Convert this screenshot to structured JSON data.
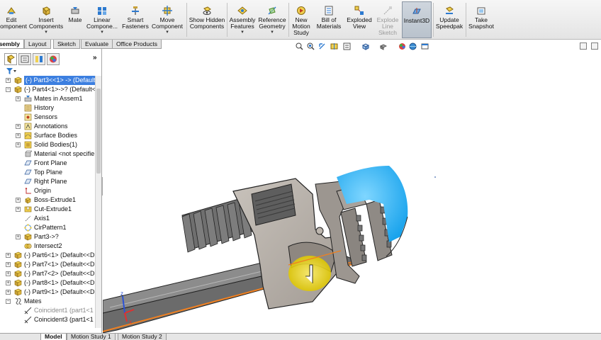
{
  "ribbon": {
    "buttons": [
      {
        "label": "Edit Component",
        "icon": "edit-component-icon"
      },
      {
        "label": "Insert Components",
        "icon": "insert-components-icon"
      },
      {
        "label": "Mate",
        "icon": "mate-icon"
      },
      {
        "label": "Linear Compone...",
        "icon": "linear-pattern-icon"
      },
      {
        "label": "Smart Fasteners",
        "icon": "smart-fasteners-icon"
      },
      {
        "label": "Move Component",
        "icon": "move-component-icon"
      },
      {
        "label": "Show Hidden Components",
        "icon": "show-hidden-icon"
      },
      {
        "label": "Assembly Features",
        "icon": "assembly-features-icon"
      },
      {
        "label": "Reference Geometry",
        "icon": "reference-geometry-icon"
      },
      {
        "label": "New Motion Study",
        "icon": "motion-study-icon"
      },
      {
        "label": "Bill of Materials",
        "icon": "bom-icon"
      },
      {
        "label": "Exploded View",
        "icon": "exploded-view-icon"
      },
      {
        "label": "Explode Line Sketch",
        "icon": "explode-line-icon"
      },
      {
        "label": "Instant3D",
        "icon": "instant3d-icon"
      },
      {
        "label": "Update Speedpak",
        "icon": "speedpak-icon"
      },
      {
        "label": "Take Snapshot",
        "icon": "snapshot-icon"
      }
    ]
  },
  "command_tabs": [
    "Assembly",
    "Layout",
    "Sketch",
    "Evaluate",
    "Office Products"
  ],
  "tree": {
    "nodes": [
      {
        "label": "(-) Part3<<1> -> (Default"
      },
      {
        "label": "(-) Part4<1>->? (Default<"
      },
      {
        "label": "Mates in Assem1"
      },
      {
        "label": "History"
      },
      {
        "label": "Sensors"
      },
      {
        "label": "Annotations"
      },
      {
        "label": "Surface Bodies"
      },
      {
        "label": "Solid Bodies(1)"
      },
      {
        "label": "Material <not specifie"
      },
      {
        "label": "Front Plane"
      },
      {
        "label": "Top Plane"
      },
      {
        "label": "Right Plane"
      },
      {
        "label": "Origin"
      },
      {
        "label": "Boss-Extrude1"
      },
      {
        "label": "Cut-Extrude1"
      },
      {
        "label": "Axis1"
      },
      {
        "label": "CirPattern1"
      },
      {
        "label": "Part3->?"
      },
      {
        "label": "Intersect2"
      },
      {
        "label": "(-) Part6<1> (Default<<D"
      },
      {
        "label": "(-) Part7<1> (Default<<D"
      },
      {
        "label": "(-) Part7<2> (Default<<D"
      },
      {
        "label": "(-) Part8<1> (Default<<D"
      },
      {
        "label": "(-) Part9<1> (Default<<D"
      },
      {
        "label": "Mates"
      },
      {
        "label": "Coincident1 (part1<1"
      },
      {
        "label": "Coincident3 (part1<1"
      }
    ]
  },
  "bottom_tabs": [
    "Model",
    "Motion Study 1",
    "Motion Study 2"
  ],
  "triad": {
    "z": "z",
    "x": "x"
  },
  "colors": {
    "accent": "#3c7fe0",
    "selected_face": "#2fb4f0",
    "highlight": "#f0e020",
    "edge": "#f08020"
  }
}
